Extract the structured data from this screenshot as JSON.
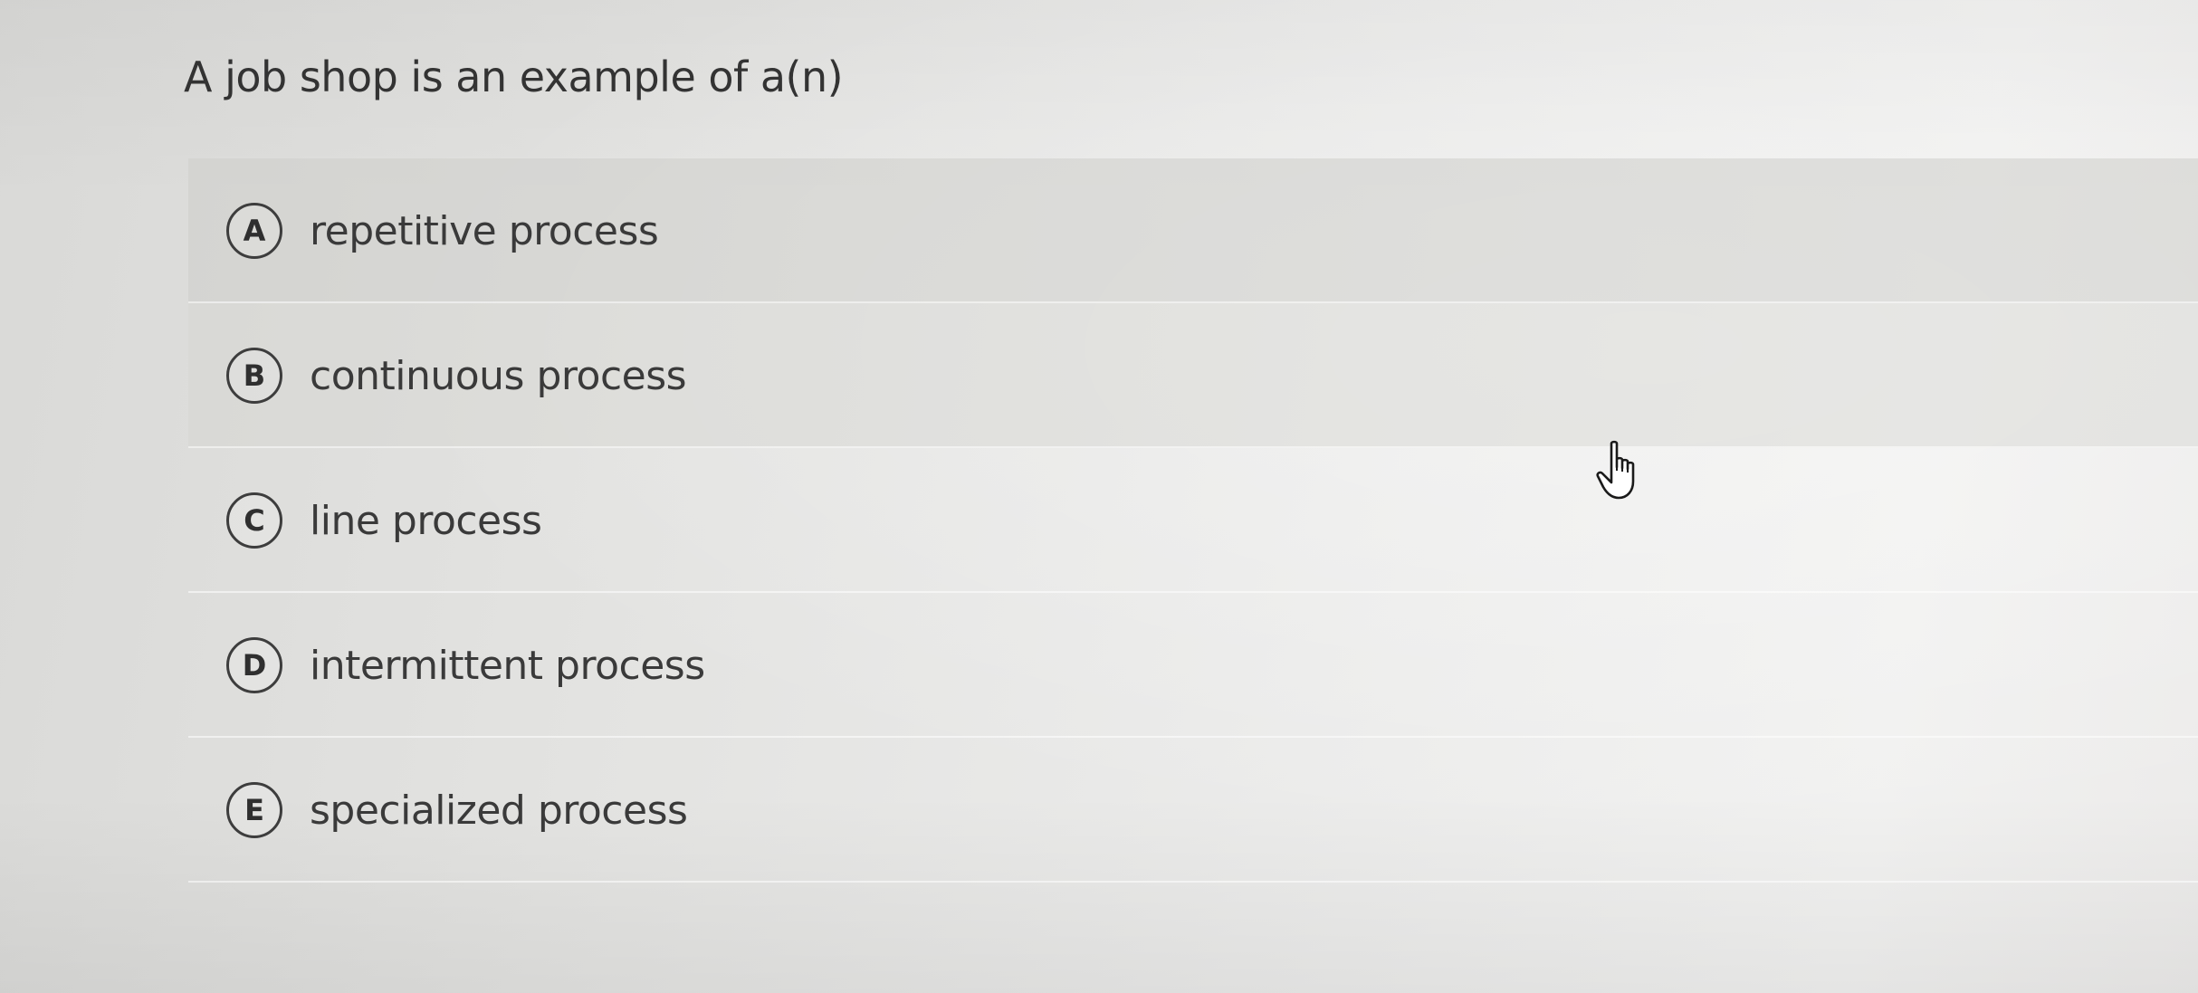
{
  "question": {
    "text": "A job shop is an example of a(n)"
  },
  "options": [
    {
      "letter": "A",
      "label": "repetitive process"
    },
    {
      "letter": "B",
      "label": "continuous process"
    },
    {
      "letter": "C",
      "label": "line process"
    },
    {
      "letter": "D",
      "label": "intermittent process"
    },
    {
      "letter": "E",
      "label": "specialized process"
    }
  ],
  "cursor": {
    "icon": "hand-pointer-icon"
  },
  "colors": {
    "background": "#e6e6e4",
    "text": "#3a3a3a",
    "option_highlight": "#cdcdca"
  }
}
